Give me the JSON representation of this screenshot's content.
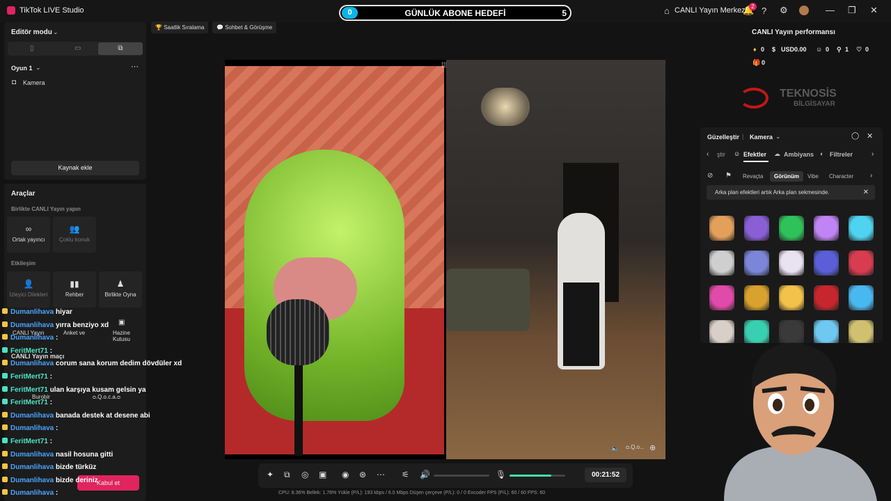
{
  "titlebar": {
    "app_title": "TikTok LIVE Studio",
    "goal": {
      "start": "0",
      "title": "GÜNLÜK ABONE HEDEFİ",
      "target": "5"
    },
    "center_label": "CANLI Yayın Merkezi",
    "notification_count": "2"
  },
  "left": {
    "editor_mode": "Editör modu",
    "scene_name": "Oyun 1",
    "source_camera": "Kamera",
    "add_source": "Kaynak ekle",
    "tools_title": "Araçlar",
    "together_title": "Birlikte CANLI Yayın yapın",
    "cohost": "Ortak yayıncı",
    "multi_guest": "Çoklu konuk",
    "interaction_title": "Etkileşim",
    "viewer_requests": "İzleyici Dilekleri",
    "guide": "Rehber",
    "play_together": "Birlikte Oyna",
    "live_tournament": "CANLI Yayın",
    "poll": "Anket ve",
    "treasure": "Hazine Kutusu",
    "live_match": "CANLI Yayın maçı",
    "match_user_1": "Burobir",
    "match_user_2": "ᴑ.Q.o.c.a.ᴑ",
    "accept_button": "Kabul et"
  },
  "pills": {
    "hourly_rank": "Saatlik Sıralama",
    "chat_meet": "Sohbet & Görüşme"
  },
  "stage": {
    "right_user": "ᴑ.Q.o..."
  },
  "chat": [
    {
      "user": "Dumanlihava",
      "msg": "hiyar",
      "type": "1"
    },
    {
      "user": "Dumanlihava",
      "msg": "yırra benziyo xd",
      "type": "1"
    },
    {
      "user": "Dumanlihava",
      "msg": ":",
      "type": "1"
    },
    {
      "user": "FeritMert71",
      "msg": ":",
      "type": "2"
    },
    {
      "user": "Dumanlihava",
      "msg": "corum sana korum dedim dövdüler xd",
      "type": "1"
    },
    {
      "user": "FeritMert71",
      "msg": ":",
      "type": "2"
    },
    {
      "user": "FeritMert71",
      "msg": "ulan karşıya kusam gelsin ya",
      "type": "2"
    },
    {
      "user": "FeritMert71",
      "msg": ":",
      "type": "2"
    },
    {
      "user": "Dumanlihava",
      "msg": "banada destek at desene abi",
      "type": "1"
    },
    {
      "user": "Dumanlihava",
      "msg": ":",
      "type": "1"
    },
    {
      "user": "FeritMert71",
      "msg": ":",
      "type": "2"
    },
    {
      "user": "Dumanlihava",
      "msg": "nasil hosuna gitti",
      "type": "1"
    },
    {
      "user": "Dumanlihava",
      "msg": "bizde türküz",
      "type": "1"
    },
    {
      "user": "Dumanlihava",
      "msg": "bizde deriniz",
      "type": "1"
    },
    {
      "user": "Dumanlihava",
      "msg": ":",
      "type": "1"
    }
  ],
  "controls": {
    "timer": "00:21:52",
    "volume_level": 0.0,
    "mic_level": 0.75
  },
  "stats": "CPU: 8.36%     Bellek: 1.78%     Yükle (P/L): 193 kbps / 6.0 Mbps     Düşen çerçeve (P/L): 0 / 0     Encoder FPS (P/L): 60 / 60     FPS: 60",
  "performance": {
    "title": "CANLI Yayın performansı",
    "diamonds": "0",
    "usd": "USD0.00",
    "viewers": "0",
    "followers": "1",
    "likes": "0",
    "gifts": "0"
  },
  "logo": {
    "brand": "TEKNOSİS",
    "sub": "BİLGİSAYAR"
  },
  "beauty": {
    "title": "Güzelleştir",
    "source": "Kamera",
    "tab_partial": "ştir",
    "tabs": [
      "Efektler",
      "Ambiyans",
      "Filtreler"
    ],
    "categories": [
      "Revaçta",
      "Görünüm",
      "Vibe",
      "Character"
    ],
    "notice": "Arka plan efektleri artık Arka plan sekmesinde.",
    "effect_colors": [
      "#e3a05a",
      "#8a5fd6",
      "#2fc25a",
      "#c084f5",
      "#4fd3f0",
      "#cfcfcf",
      "#7b86d8",
      "#e9e2f0",
      "#5a5fd8",
      "#d83d4f",
      "#e04aa8",
      "#d9a12e",
      "#f2c24a",
      "#c8262e",
      "#4ab8f0",
      "#d8d0c8",
      "#38d0b0",
      "#3a3a3a",
      "#6ec8f0",
      "#d0c070"
    ]
  },
  "colors": {
    "accent": "#e0245e",
    "goal": "#0ab6e8",
    "user1": "#4aa5ff",
    "user2": "#4be3c4",
    "mic": "#3ce6a8"
  }
}
